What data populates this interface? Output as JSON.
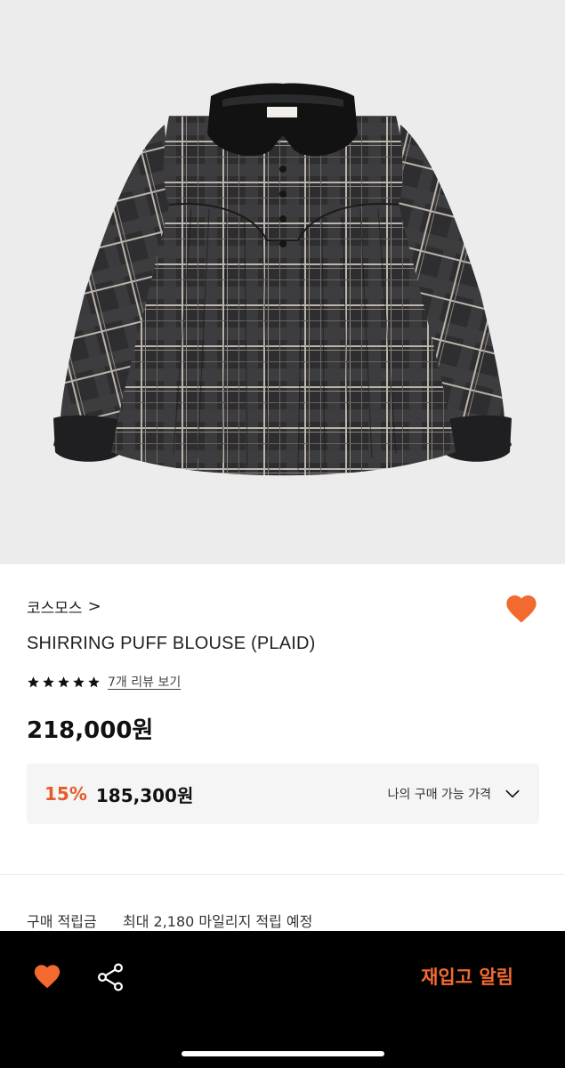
{
  "product": {
    "brand": "코스모스",
    "brand_chevron": ">",
    "name": "SHIRRING PUFF BLOUSE (PLAID)",
    "rating_stars": 5,
    "review_link": "7개 리뷰 보기",
    "price": "218,000원",
    "image_icon": "plaid-blouse-image"
  },
  "my_price": {
    "discount": "15%",
    "sale_price": "185,300원",
    "label": "나의 구매 가능 가격"
  },
  "points": {
    "label": "구매 적립금",
    "value": "최대 2,180 마일리지 적립 예정"
  },
  "bottom_bar": {
    "restock_label": "재입고 알림"
  },
  "colors": {
    "accent": "#f26a30",
    "discount": "#e85a2a",
    "bar": "#000000",
    "hero_bg": "#ececec"
  }
}
